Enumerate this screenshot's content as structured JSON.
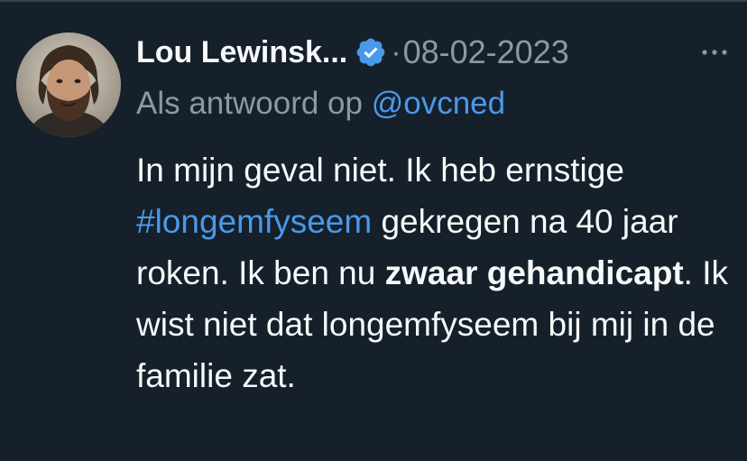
{
  "tweet": {
    "author_name": "Lou Lewinsk...",
    "separator": "·",
    "date": "08-02-2023",
    "reply_prefix": "Als antwoord op ",
    "reply_handle": "@ovcned",
    "verified_icon": "verified-badge-icon",
    "more_icon": "ellipsis-icon",
    "accent_color": "#4a99e9",
    "body": {
      "part1": "In mijn geval niet. Ik heb ernstige ",
      "hashtag": "#longemfyseem",
      "part2": " gekregen na 40 jaar roken. Ik ben nu ",
      "bold": "zwaar gehandicapt",
      "part3": ". Ik wist niet dat longemfyseem bij mij in de familie zat."
    }
  }
}
